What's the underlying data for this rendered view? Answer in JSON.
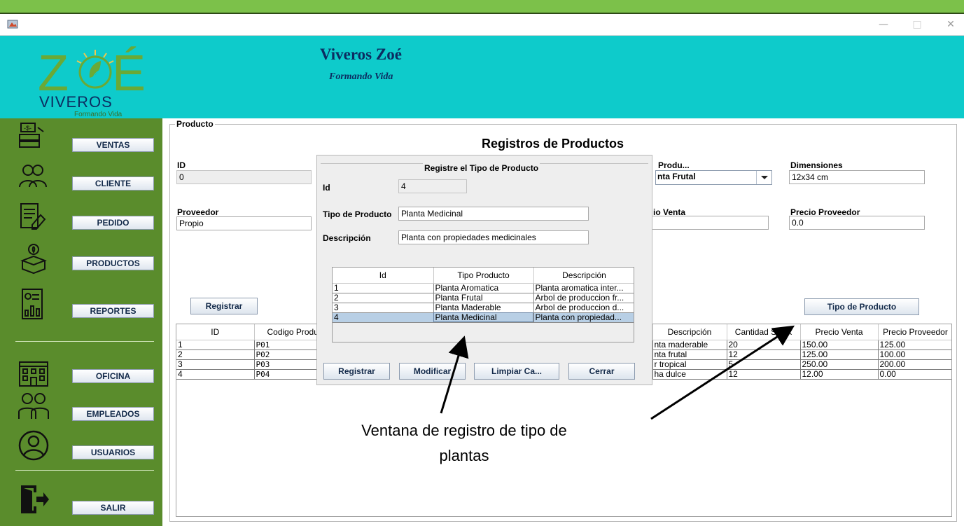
{
  "header": {
    "title": "Viveros Zoé",
    "subtitle": "Formando Vida",
    "logo": {
      "brand": "ZOÉ",
      "name": "VIVEROS",
      "tagline": "Formando Vida"
    }
  },
  "sidebar": {
    "items": [
      {
        "label": "VENTAS",
        "icon": "sales-register-icon"
      },
      {
        "label": "CLIENTE",
        "icon": "clients-icon"
      },
      {
        "label": "PEDIDO",
        "icon": "order-form-icon"
      },
      {
        "label": "PRODUCTOS",
        "icon": "plant-box-icon"
      },
      {
        "label": "REPORTES",
        "icon": "report-chart-icon"
      },
      {
        "label": "OFICINA",
        "icon": "office-building-icon"
      },
      {
        "label": "EMPLEADOS",
        "icon": "employees-icon"
      },
      {
        "label": "USUARIOS",
        "icon": "user-circle-icon"
      },
      {
        "label": "SALIR",
        "icon": "exit-door-icon"
      }
    ]
  },
  "panel": {
    "legend": "Producto",
    "heading": "Registros de Productos",
    "fields": {
      "id_label": "ID",
      "id_value": "0",
      "tipo_label": "Produ...",
      "tipo_value": "nta Frutal",
      "dimensiones_label": "Dimensiones",
      "dimensiones_value": "12x34 cm",
      "proveedor_label": "Proveedor",
      "proveedor_value": "Propio",
      "precio_venta_label": "io Venta",
      "precio_venta_value": "",
      "precio_proveedor_label": "Precio Proveedor",
      "precio_proveedor_value": "0.0"
    },
    "registrar_label": "Registrar",
    "tipo_producto_label": "Tipo de Producto",
    "table": {
      "left_headers": [
        "ID",
        "Codigo Produ"
      ],
      "right_headers": [
        "Descripción",
        "Cantidad Stock",
        "Precio Venta",
        "Precio Proveedor"
      ],
      "rows": [
        {
          "id": "1",
          "codigo": "P01",
          "descripcion": "nta maderable",
          "stock": "20",
          "precio_venta": "150.00",
          "precio_proveedor": "125.00"
        },
        {
          "id": "2",
          "codigo": "P02",
          "descripcion": "nta frutal",
          "stock": "12",
          "precio_venta": "125.00",
          "precio_proveedor": "100.00"
        },
        {
          "id": "3",
          "codigo": "P03",
          "descripcion": "r tropical",
          "stock": "5",
          "precio_venta": "250.00",
          "precio_proveedor": "200.00"
        },
        {
          "id": "4",
          "codigo": "P04",
          "descripcion": "ha dulce",
          "stock": "12",
          "precio_venta": "12.00",
          "precio_proveedor": "0.00"
        }
      ]
    }
  },
  "dialog": {
    "legend": "Registre el Tipo de Producto",
    "id_label": "Id",
    "id_value": "4",
    "tipo_label": "Tipo de Producto",
    "tipo_value": "Planta Medicinal",
    "desc_label": "Descripción",
    "desc_value": "Planta con propiedades medicinales",
    "table": {
      "headers": [
        "Id",
        "Tipo Producto",
        "Descripción"
      ],
      "rows": [
        {
          "id": "1",
          "tipo": "Planta Aromatica",
          "desc": "Planta aromatica inter..."
        },
        {
          "id": "2",
          "tipo": "Planta Frutal",
          "desc": "Arbol de produccion fr..."
        },
        {
          "id": "3",
          "tipo": "Planta Maderable",
          "desc": "Arbol de produccion d..."
        },
        {
          "id": "4",
          "tipo": "Planta Medicinal",
          "desc": "Planta con propiedad...",
          "selected": true
        }
      ]
    },
    "buttons": {
      "registrar": "Registrar",
      "modificar": "Modificar",
      "limpiar": "Limpiar Ca...",
      "cerrar": "Cerrar"
    }
  },
  "annotation": {
    "text": "Ventana de registro de tipo de plantas"
  },
  "colors": {
    "header_bg": "#0ecbcb",
    "sidebar_bg": "#5a8c2c",
    "title_color": "#0c2d61",
    "selection": "#b8cfe5"
  }
}
